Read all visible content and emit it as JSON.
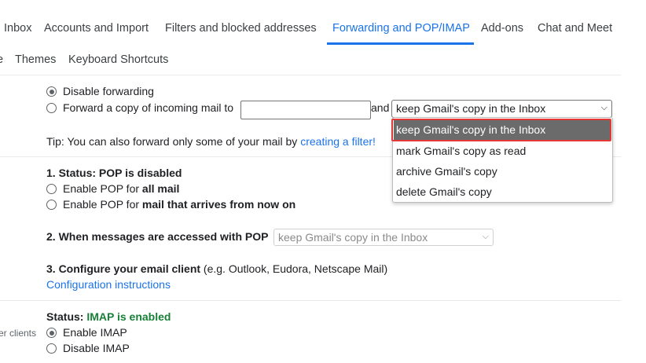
{
  "tabs": {
    "inbox": "Inbox",
    "accounts": "Accounts and Import",
    "filters": "Filters and blocked addresses",
    "forwarding": "Forwarding and POP/IMAP",
    "addons": "Add-ons",
    "chat": "Chat and Meet",
    "cut": "e",
    "themes": "Themes",
    "shortcuts": "Keyboard Shortcuts"
  },
  "forwarding": {
    "disable": "Disable forwarding",
    "forward_copy": "Forward a copy of incoming mail to",
    "forward_address_value": "",
    "and": "and",
    "action_selected": "keep Gmail's copy in the Inbox",
    "options": [
      "keep Gmail's copy in the Inbox",
      "mark Gmail's copy as read",
      "archive Gmail's copy",
      "delete Gmail's copy"
    ],
    "tip_prefix": "Tip: You can also forward only some of your mail by ",
    "tip_link": "creating a filter!"
  },
  "pop": {
    "status_label": "1. Status: POP is disabled",
    "enable_all_prefix": "Enable POP for ",
    "enable_all_bold": "all mail",
    "enable_now_prefix": "Enable POP for ",
    "enable_now_bold": "mail that arrives from now on",
    "access_label": "2. When messages are accessed with POP",
    "access_selected": "keep Gmail's copy in the Inbox",
    "configure_label": "3. Configure your email client",
    "configure_hint": " (e.g. Outlook, Eudora, Netscape Mail)",
    "config_link": "Configuration instructions"
  },
  "imap": {
    "status_prefix": "Status: ",
    "status_value": "IMAP is enabled",
    "side_label": "er clients",
    "enable": "Enable IMAP",
    "disable": "Disable IMAP"
  },
  "colors": {
    "accent": "#1a73e8",
    "enabled_green": "#188038",
    "highlight_red": "#e53935",
    "selected_option_bg": "#6b6b6b"
  }
}
